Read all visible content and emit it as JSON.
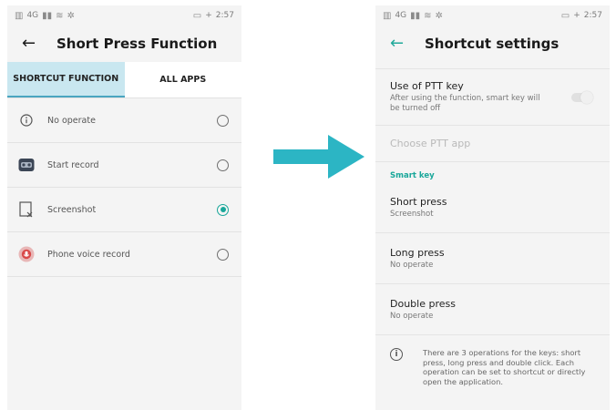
{
  "left": {
    "status": {
      "carrier": "4G",
      "time": "2:57",
      "battery": "+"
    },
    "title": "Short Press Function",
    "tabs": [
      {
        "label": "SHORTCUT FUNCTION",
        "active": true
      },
      {
        "label": "ALL APPS",
        "active": false
      }
    ],
    "options": [
      {
        "label": "No operate",
        "icon": "info-icon",
        "selected": false
      },
      {
        "label": "Start record",
        "icon": "record-app-icon",
        "selected": false
      },
      {
        "label": "Screenshot",
        "icon": "screenshot-icon",
        "selected": true
      },
      {
        "label": "Phone voice record",
        "icon": "voice-record-app-icon",
        "selected": false
      }
    ]
  },
  "right": {
    "status": {
      "carrier": "4G",
      "time": "2:57",
      "battery": "+"
    },
    "title": "Shortcut settings",
    "ptt": {
      "title": "Use of PTT key",
      "subtitle": "After using the function, smart key will be turned off",
      "enabled": false
    },
    "choose_ptt": "Choose PTT app",
    "section": "Smart key",
    "short_press": {
      "title": "Short press",
      "value": "Screenshot"
    },
    "long_press": {
      "title": "Long press",
      "value": "No operate"
    },
    "double_press": {
      "title": "Double press",
      "value": "No operate"
    },
    "info": "There are 3 operations for the keys: short press, long press and double click. Each operation can be set to shortcut or directly open the application."
  },
  "colors": {
    "accent": "#19a79a",
    "arrow": "#2cb5c4",
    "tab_active_bg": "#c9e7f0"
  }
}
